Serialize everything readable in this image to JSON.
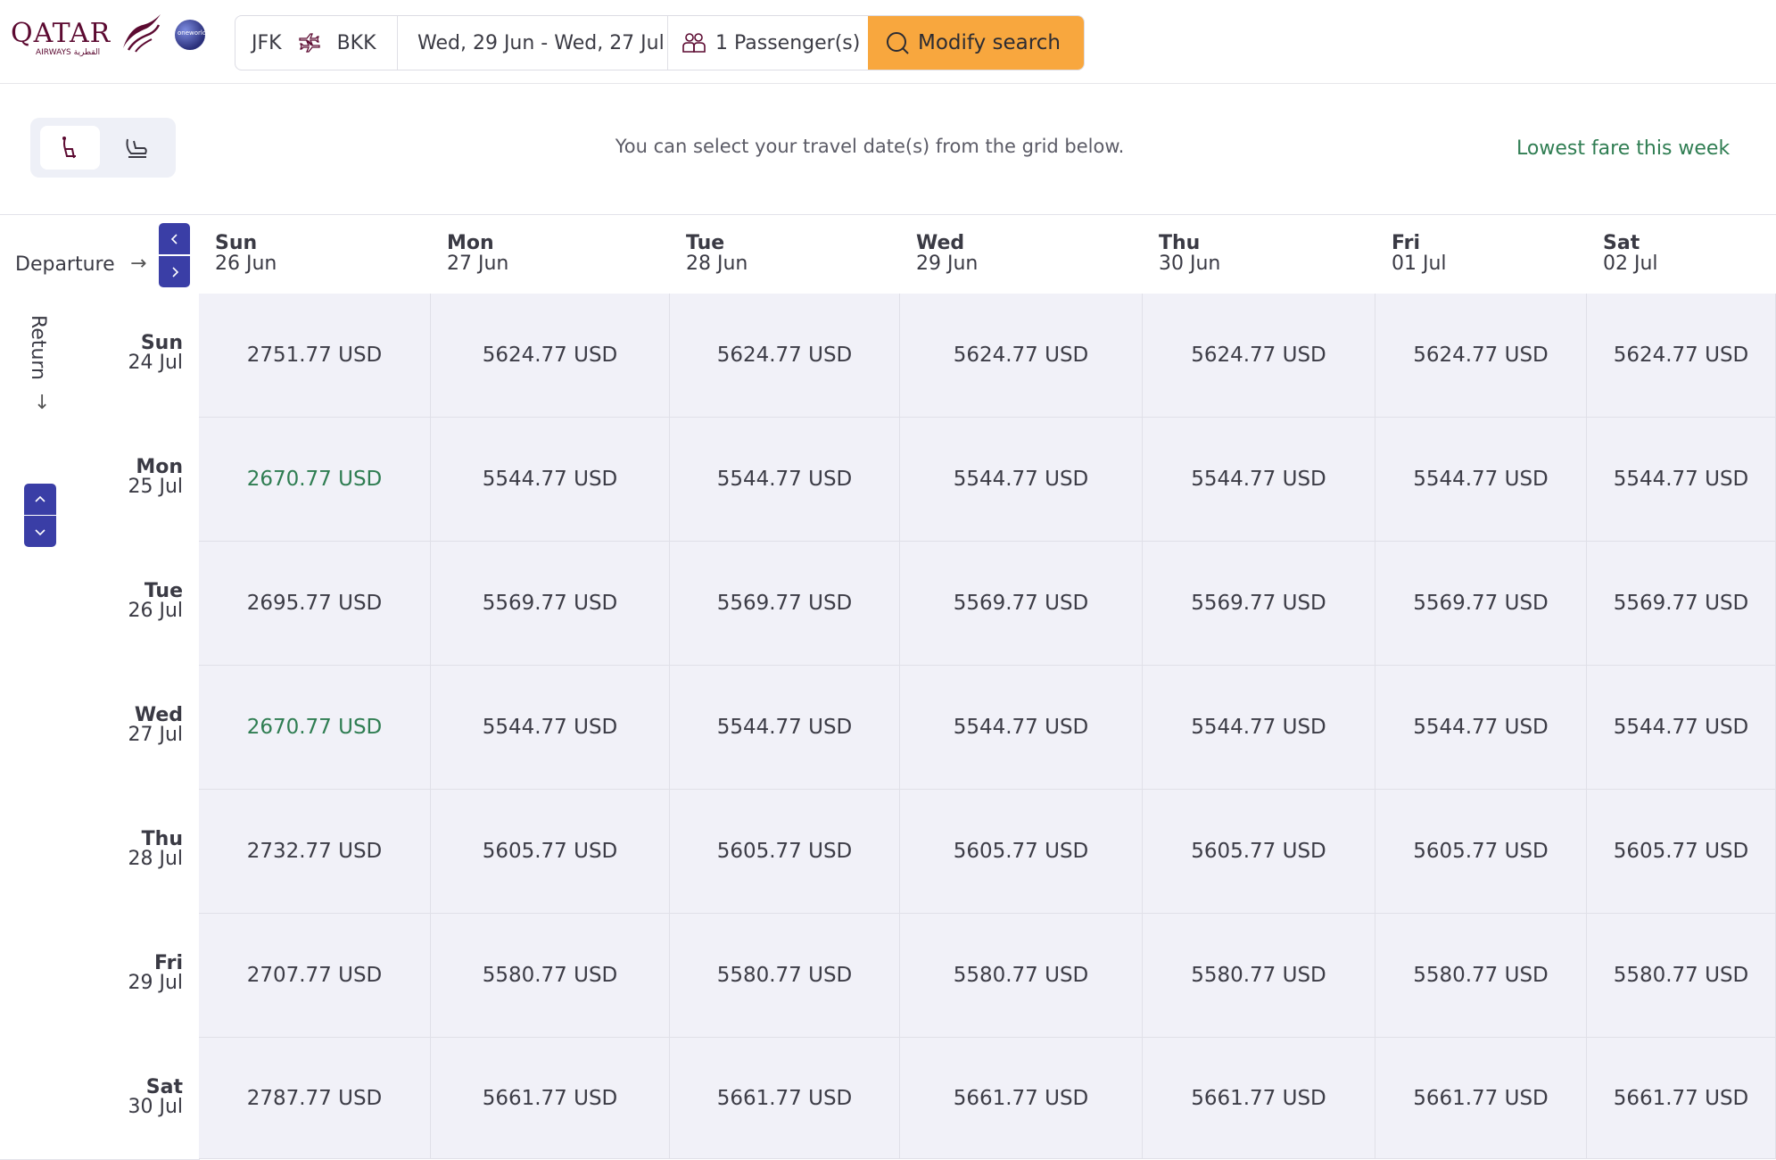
{
  "header": {
    "logo_text": "QATAR",
    "logo_sub": "AIRWAYS القطرية",
    "alliance_badge": "oneworld",
    "search": {
      "origin": "JFK",
      "destination": "BKK",
      "dates": "Wed, 29 Jun - Wed, 27 Jul",
      "passengers": "1 Passenger(s)",
      "modify_label": "Modify search"
    }
  },
  "toolbar": {
    "hint": "You can select your travel date(s) from the grid below.",
    "lowest_fare_link": "Lowest fare this week"
  },
  "grid": {
    "departure_label": "Departure",
    "return_label": "Return",
    "columns": [
      {
        "day": "Sun",
        "date": "26 Jun"
      },
      {
        "day": "Mon",
        "date": "27 Jun"
      },
      {
        "day": "Tue",
        "date": "28 Jun"
      },
      {
        "day": "Wed",
        "date": "29 Jun"
      },
      {
        "day": "Thu",
        "date": "30 Jun"
      },
      {
        "day": "Fri",
        "date": "01 Jul"
      },
      {
        "day": "Sat",
        "date": "02 Jul"
      }
    ],
    "rows": [
      {
        "day": "Sun",
        "date": "24 Jul",
        "fares": [
          "2751.77 USD",
          "5624.77 USD",
          "5624.77 USD",
          "5624.77 USD",
          "5624.77 USD",
          "5624.77 USD",
          "5624.77 USD"
        ]
      },
      {
        "day": "Mon",
        "date": "25 Jul",
        "fares": [
          "2670.77 USD",
          "5544.77 USD",
          "5544.77 USD",
          "5544.77 USD",
          "5544.77 USD",
          "5544.77 USD",
          "5544.77 USD"
        ]
      },
      {
        "day": "Tue",
        "date": "26 Jul",
        "fares": [
          "2695.77 USD",
          "5569.77 USD",
          "5569.77 USD",
          "5569.77 USD",
          "5569.77 USD",
          "5569.77 USD",
          "5569.77 USD"
        ]
      },
      {
        "day": "Wed",
        "date": "27 Jul",
        "fares": [
          "2670.77 USD",
          "5544.77 USD",
          "5544.77 USD",
          "5544.77 USD",
          "5544.77 USD",
          "5544.77 USD",
          "5544.77 USD"
        ]
      },
      {
        "day": "Thu",
        "date": "28 Jul",
        "fares": [
          "2732.77 USD",
          "5605.77 USD",
          "5605.77 USD",
          "5605.77 USD",
          "5605.77 USD",
          "5605.77 USD",
          "5605.77 USD"
        ]
      },
      {
        "day": "Fri",
        "date": "29 Jul",
        "fares": [
          "2707.77 USD",
          "5580.77 USD",
          "5580.77 USD",
          "5580.77 USD",
          "5580.77 USD",
          "5580.77 USD",
          "5580.77 USD"
        ]
      },
      {
        "day": "Sat",
        "date": "30 Jul",
        "fares": [
          "2787.77 USD",
          "5661.77 USD",
          "5661.77 USD",
          "5661.77 USD",
          "5661.77 USD",
          "5661.77 USD",
          "5661.77 USD"
        ]
      }
    ],
    "lowest_fare": "2670.77 USD"
  },
  "colors": {
    "brand": "#5c0a31",
    "accent_button": "#f8a73e",
    "nav_button": "#3a3ea6",
    "lowest_fare_text": "#2f7d52",
    "cell_background": "#f1f1f8"
  },
  "icons": {
    "search": "search-icon",
    "swap": "plane-swap-icon",
    "passengers": "passengers-icon",
    "seat": "seat-icon",
    "lounge": "lounge-icon"
  }
}
